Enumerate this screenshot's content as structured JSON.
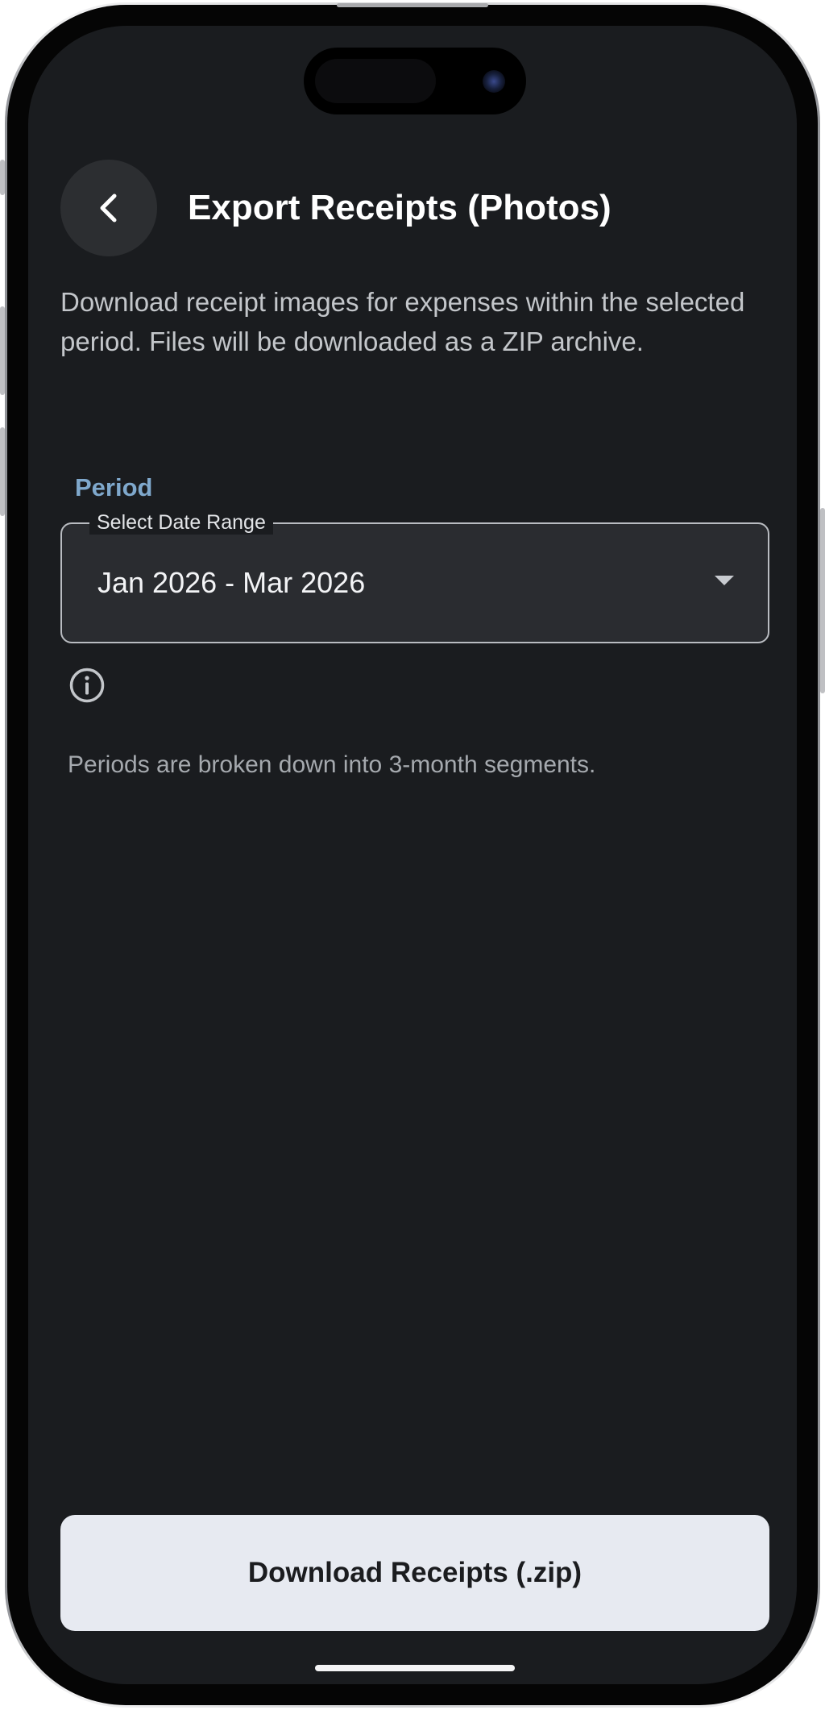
{
  "header": {
    "title": "Export Receipts (Photos)",
    "back_icon": "chevron-left-icon"
  },
  "description": "Download receipt images for expenses within the selected period. Files will be downloaded as a ZIP archive.",
  "period": {
    "section_label": "Period",
    "field_label": "Select Date Range",
    "selected_value": "Jan 2026 - Mar 2026",
    "dropdown_icon": "caret-down-icon"
  },
  "info": {
    "icon": "info-icon",
    "text": "Periods are broken down into 3-month segments."
  },
  "actions": {
    "download_label": "Download Receipts (.zip)"
  },
  "colors": {
    "background": "#1a1c1f",
    "accent_label": "#7fa8cc",
    "button_background": "#e7eaf1",
    "button_text": "#1b1c1f"
  }
}
